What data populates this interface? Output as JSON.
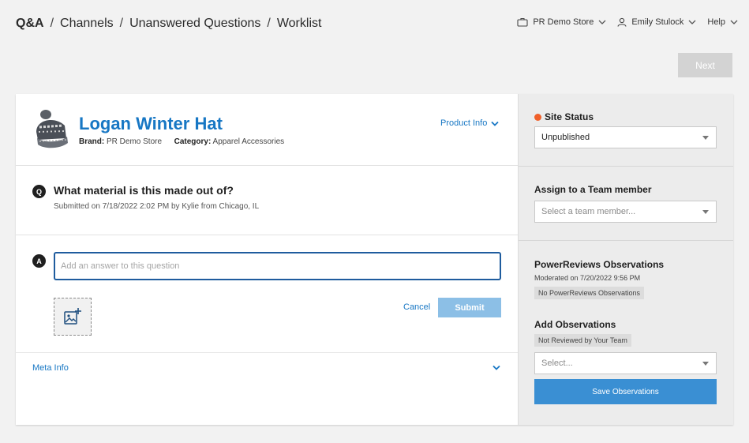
{
  "breadcrumb": {
    "root": "Q&A",
    "separator": "/",
    "items": [
      "Channels",
      "Unanswered Questions",
      "Worklist"
    ]
  },
  "topnav": {
    "store": "PR Demo Store",
    "user": "Emily Stulock",
    "help": "Help"
  },
  "next_label": "Next",
  "product": {
    "title": "Logan Winter Hat",
    "brand_label": "Brand:",
    "brand_value": "PR Demo Store",
    "category_label": "Category:",
    "category_value": "Apparel Accessories",
    "info_label": "Product Info"
  },
  "question": {
    "badge": "Q",
    "text": "What material is this made out of?",
    "submitted": "Submitted on 7/18/2022 2:02 PM by Kylie from Chicago, IL"
  },
  "answer": {
    "badge": "A",
    "placeholder": "Add an answer to this question",
    "value": "",
    "cancel_label": "Cancel",
    "submit_label": "Submit"
  },
  "meta": {
    "label": "Meta Info"
  },
  "sidebar": {
    "site_status": {
      "title": "Site Status",
      "value": "Unpublished",
      "dot_color": "#f0602a"
    },
    "assign": {
      "title": "Assign to a Team member",
      "placeholder": "Select a team member..."
    },
    "observations": {
      "title": "PowerReviews Observations",
      "moderated": "Moderated on 7/20/2022 9:56 PM",
      "tag": "No PowerReviews Observations"
    },
    "add_observations": {
      "title": "Add Observations",
      "tag": "Not Reviewed by Your Team",
      "placeholder": "Select...",
      "save_label": "Save Observations"
    }
  },
  "colors": {
    "accent": "#1777c4",
    "save_button": "#3a8fd3",
    "submit_disabled": "#8cbfe6",
    "next_disabled": "#d3d3d3"
  }
}
